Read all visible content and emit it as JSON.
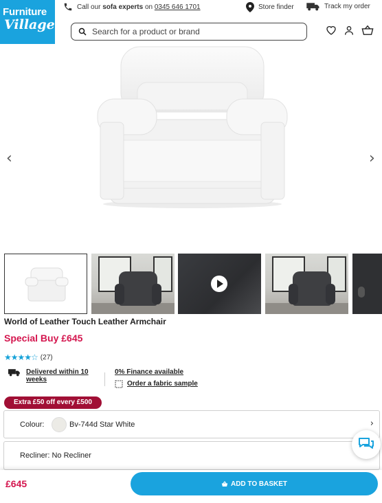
{
  "brand": {
    "line1": "Furniture",
    "line2": "Village"
  },
  "topbar": {
    "call_prefix": "Call our",
    "call_experts": "sofa experts",
    "call_on": "on",
    "phone": "0345 646 1701",
    "store_finder": "Store finder",
    "track_order": "Track my order"
  },
  "search": {
    "placeholder": "Search for a product or brand"
  },
  "gallery": {
    "prev": "‹",
    "next": "›"
  },
  "product": {
    "title": "World of Leather Touch Leather Armchair",
    "price_label": "Special Buy £645",
    "rating_stars": "★★★★☆",
    "review_count": "(27)",
    "rating": 4
  },
  "delivery": {
    "line1": "Delivered within 10",
    "line2": "weeks"
  },
  "finance": {
    "label": "0% Finance available"
  },
  "sample": {
    "label": "Order a fabric sample"
  },
  "promo": {
    "label": "Extra £50 off every £500"
  },
  "options": {
    "colour_label": "Colour:",
    "colour_value": "Bv-744d Star White",
    "recliner": "Recliner: No Recliner",
    "chevron": "›"
  },
  "footer": {
    "price": "£645",
    "add_to_basket": "ADD TO BASKET"
  },
  "colors": {
    "brand_blue": "#1aa3de",
    "price_red": "#d4154e",
    "promo_bg": "#a10f35"
  }
}
